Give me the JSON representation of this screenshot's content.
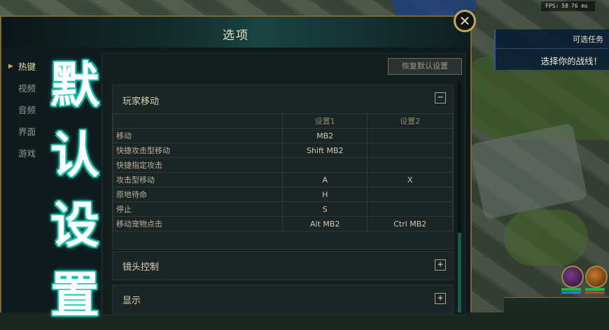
{
  "hud": {
    "fps_label": "FPS:",
    "fps_value": "58",
    "ping_value": "76 ms",
    "quest_title": "可选任务",
    "quest_prompt": "选择你的战线！"
  },
  "dialog": {
    "title": "选项",
    "close_symbol": "✕",
    "reset_label": "恢复默认设置"
  },
  "sidebar": {
    "items": [
      {
        "label": "热键"
      },
      {
        "label": "视频"
      },
      {
        "label": "音频"
      },
      {
        "label": "界面"
      },
      {
        "label": "游戏"
      }
    ]
  },
  "overlay": {
    "chars": [
      "默",
      "认",
      "设",
      "置"
    ]
  },
  "sections": {
    "movement": {
      "title": "玩家移动",
      "toggle": "−",
      "col1": "设置1",
      "col2": "设置2",
      "rows": [
        {
          "action": "移动",
          "k1": "MB2",
          "k2": ""
        },
        {
          "action": "快捷攻击型移动",
          "k1": "Shift  MB2",
          "k2": ""
        },
        {
          "action": "快捷指定攻击",
          "k1": "",
          "k2": ""
        },
        {
          "action": "攻击型移动",
          "k1": "A",
          "k2": "X"
        },
        {
          "action": "原地待命",
          "k1": "H",
          "k2": ""
        },
        {
          "action": "停止",
          "k1": "S",
          "k2": ""
        },
        {
          "action": "移动宠物点击",
          "k1": "Alt  MB2",
          "k2": "Ctrl  MB2"
        }
      ]
    },
    "camera": {
      "title": "镜头控制",
      "toggle": "+"
    },
    "display": {
      "title": "显示",
      "toggle": "+"
    }
  },
  "colors": {
    "accent_gold": "#c8a750",
    "panel_bg": "#141d1e",
    "overlay_glow": "#26d6c0"
  }
}
